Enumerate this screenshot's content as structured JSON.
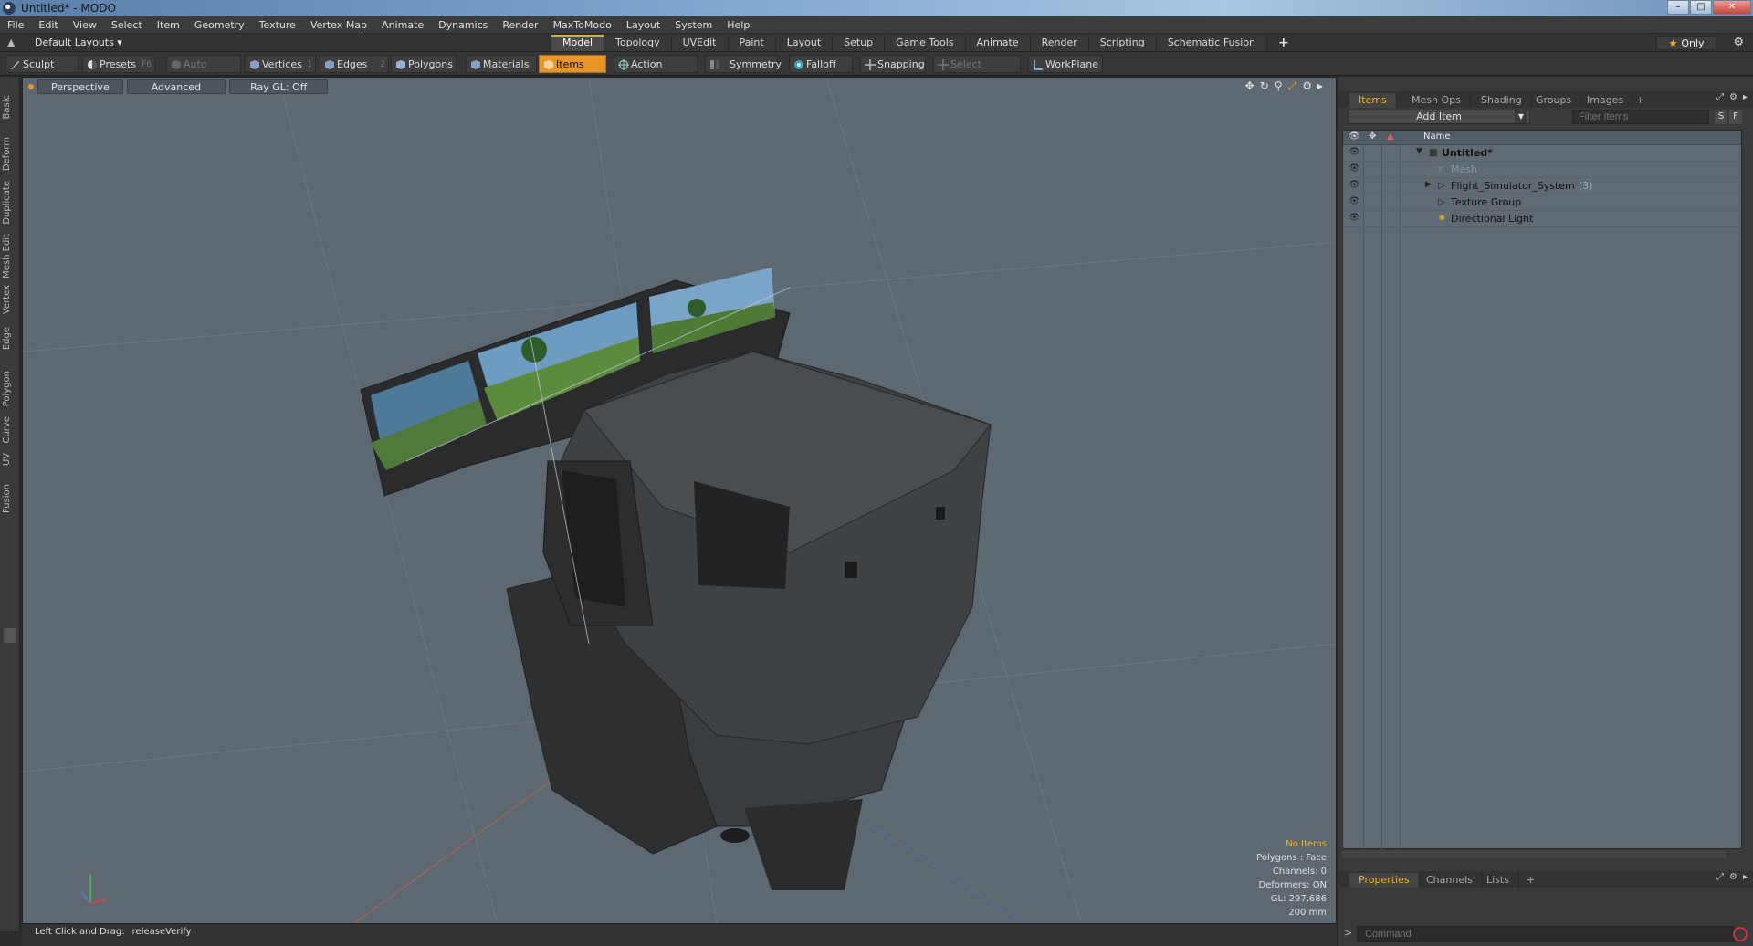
{
  "window": {
    "title": "Untitled* - MODO",
    "controls": [
      "–",
      "□",
      "✕"
    ]
  },
  "menu": [
    "File",
    "Edit",
    "View",
    "Select",
    "Item",
    "Geometry",
    "Texture",
    "Vertex Map",
    "Animate",
    "Dynamics",
    "Render",
    "MaxToModo",
    "Layout",
    "System",
    "Help"
  ],
  "layoutbar": {
    "layout_select": "Default Layouts ▾",
    "tabs": [
      "Model",
      "Topology",
      "UVEdit",
      "Paint",
      "Layout",
      "Setup",
      "Game Tools",
      "Animate",
      "Render",
      "Scripting",
      "Schematic Fusion"
    ],
    "active_tab": "Model",
    "add_tab": "+",
    "only_label": "Only"
  },
  "toolbar": {
    "sculpt": "Sculpt",
    "presets": "Presets",
    "presets_key": "F6",
    "auto_select": "Auto Select",
    "vertices": "Vertices",
    "vertices_key": "1",
    "edges": "Edges",
    "edges_key": "2",
    "polygons": "Polygons",
    "materials": "Materials",
    "items": "Items",
    "action_center": "Action Center",
    "symmetry": "Symmetry",
    "falloff": "Falloff",
    "snapping": "Snapping",
    "select_through": "Select Through",
    "workplane": "WorkPlane"
  },
  "lefttabs": [
    "Basic",
    "Deform",
    "Duplicate",
    "Mesh Edit",
    "Vertex",
    "Edge",
    "Polygon",
    "Curve",
    "UV",
    "Fusion"
  ],
  "viewport": {
    "view_mode": "Perspective",
    "shading": "Advanced",
    "raygl": "Ray GL: Off",
    "stats": {
      "selection": "No Items",
      "polygons": "Polygons : Face",
      "channels": "Channels: 0",
      "deformers": "Deformers: ON",
      "gl": "GL: 297,686",
      "scale": "200 mm"
    }
  },
  "statusbar": {
    "hint": "Left Click and Drag:",
    "action": "releaseVerify"
  },
  "rightpanel": {
    "tabs": [
      "Items",
      "Mesh Ops",
      "Shading",
      "Groups",
      "Images",
      "+"
    ],
    "active_tab": "Items",
    "add_item": "Add Item",
    "filter_placeholder": "Filter Items",
    "s_btn": "S",
    "f_btn": "F",
    "column_name": "Name",
    "tree": [
      {
        "name": "Untitled*",
        "depth": 0,
        "bold": true,
        "expanded": true
      },
      {
        "name": "Mesh",
        "depth": 1,
        "muted": true
      },
      {
        "name": "Flight_Simulator_System",
        "depth": 1,
        "count": "(3)",
        "collapsed": true
      },
      {
        "name": "Texture Group",
        "depth": 1
      },
      {
        "name": "Directional Light",
        "depth": 1
      }
    ],
    "props_tabs": [
      "Properties",
      "Channels",
      "Lists",
      "+"
    ],
    "props_active": "Properties",
    "command_placeholder": "Command"
  },
  "colors": {
    "accent": "#e89528",
    "highlight_text": "#f0b020",
    "viewport_bg": "#5d6870",
    "panel_bg": "#3a3a3a"
  }
}
